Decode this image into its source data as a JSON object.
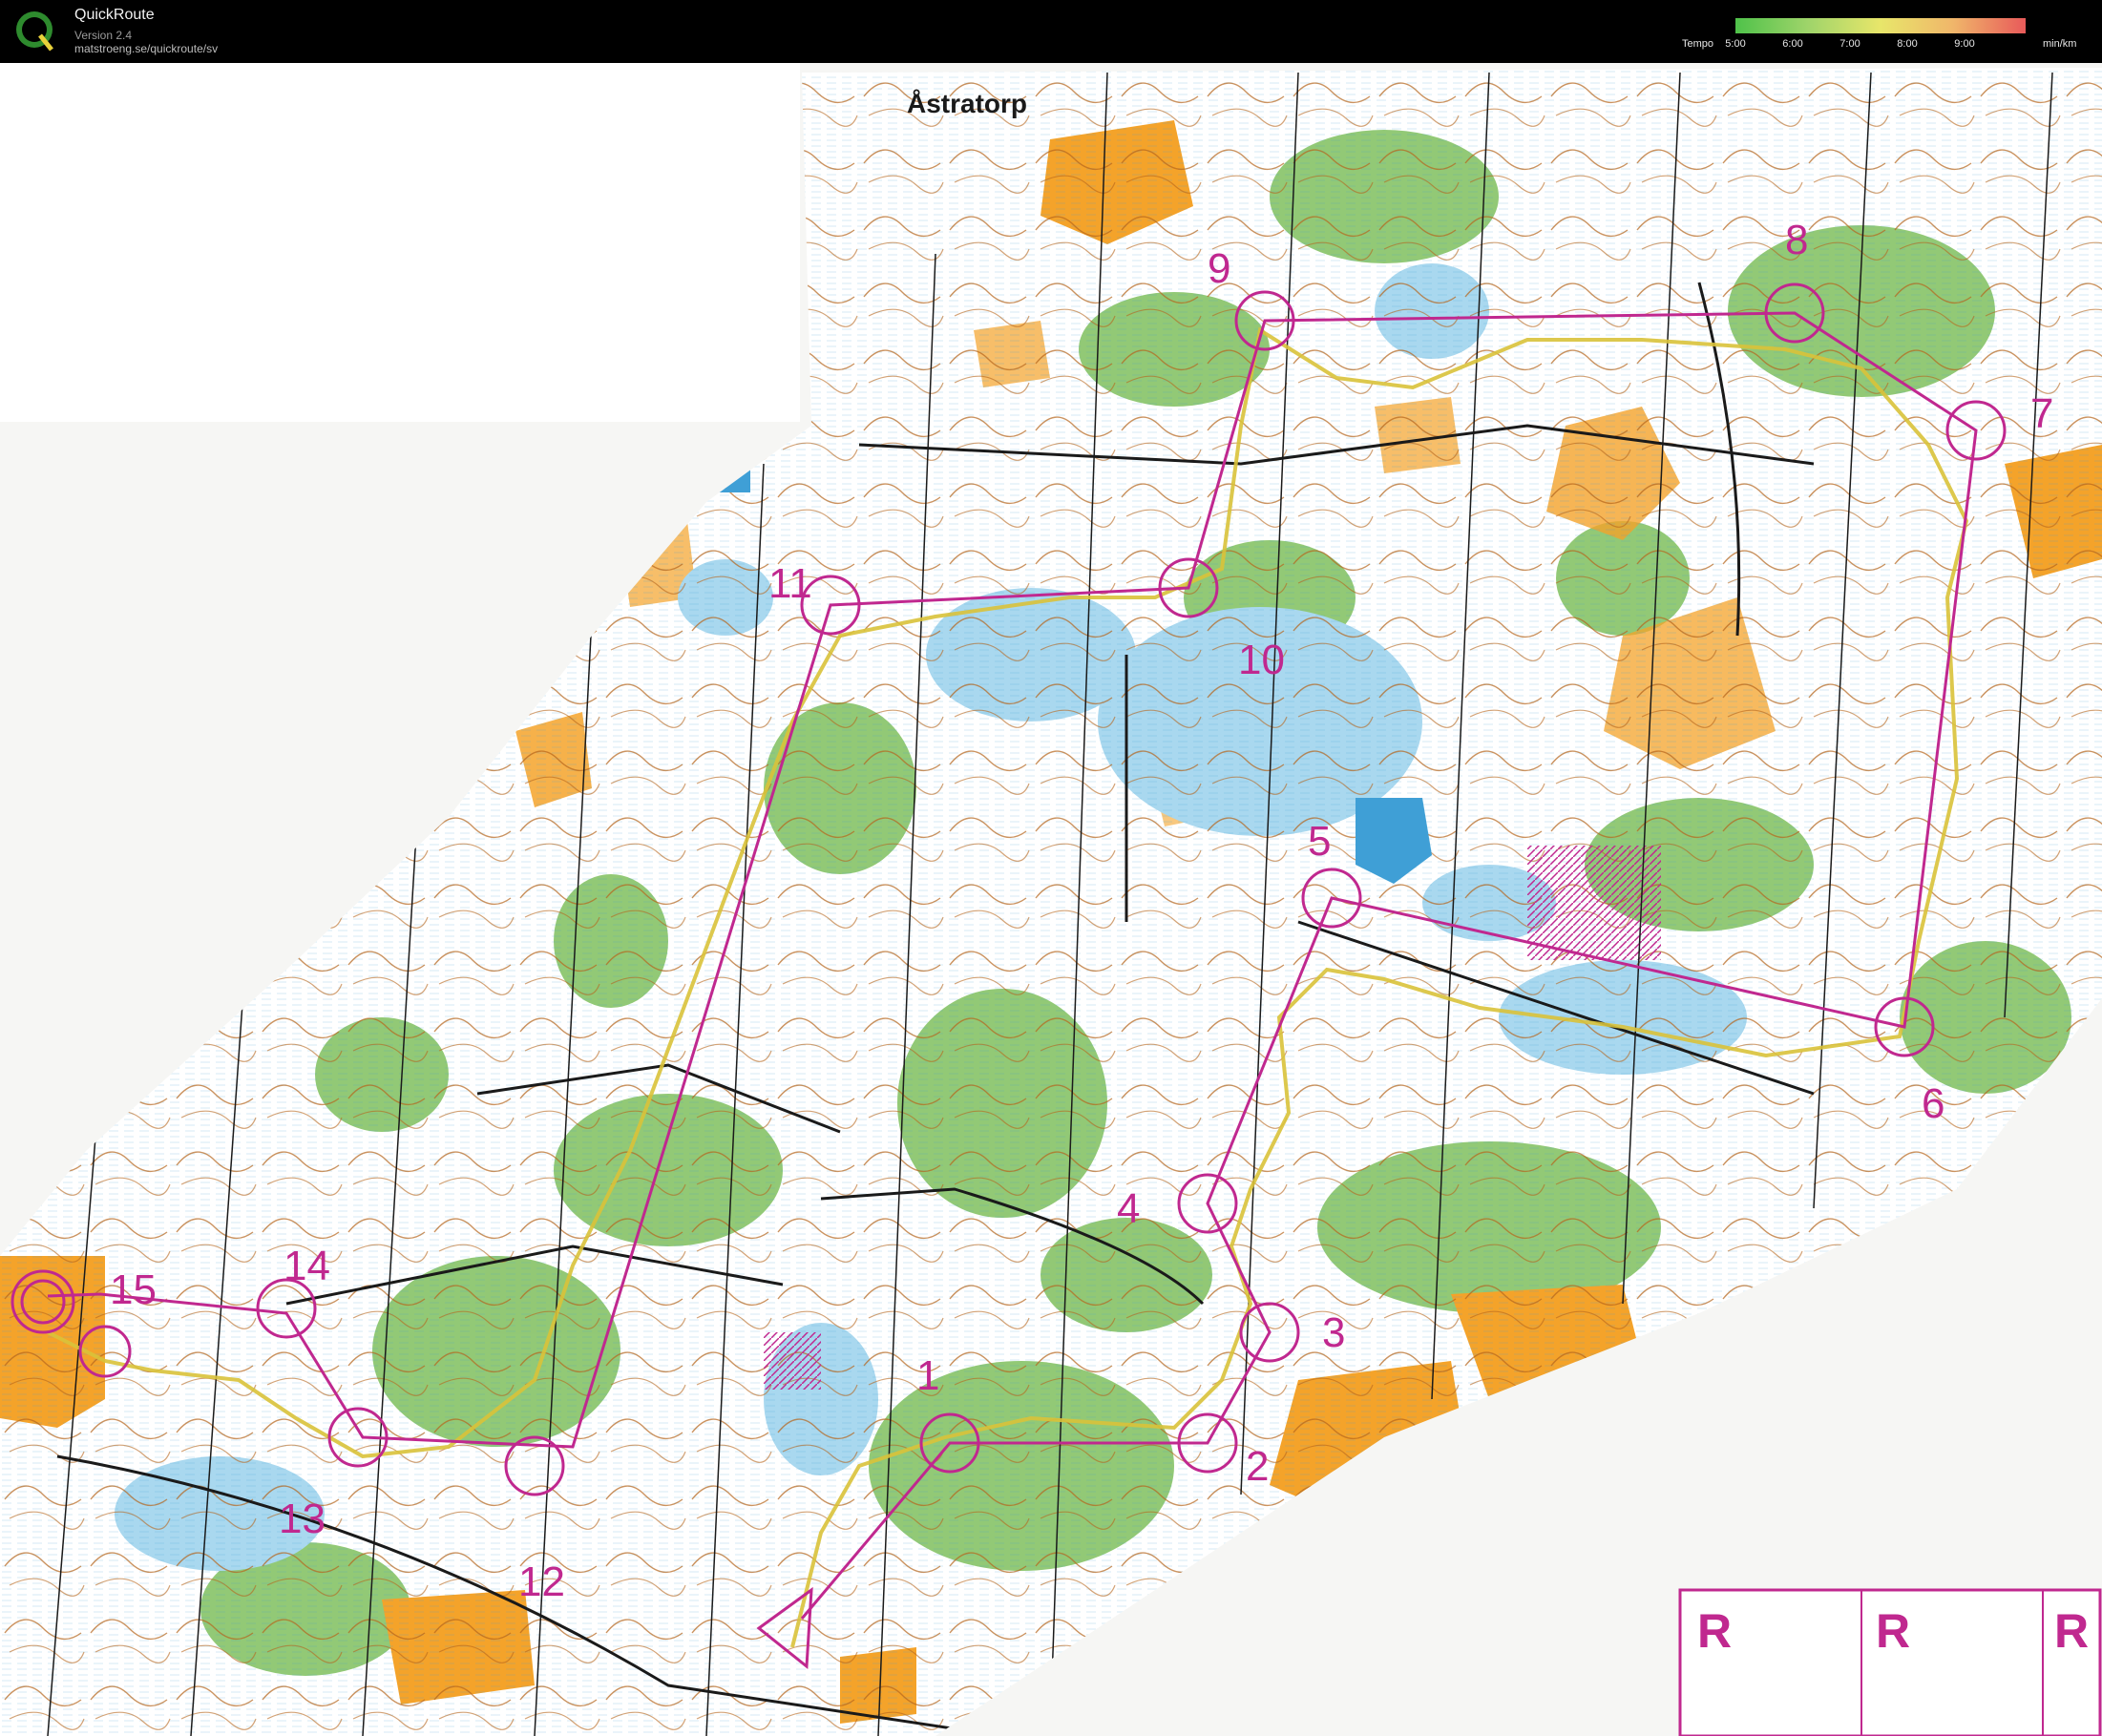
{
  "app": {
    "name": "QuickRoute",
    "version": "Version 2.4",
    "url": "matstroeng.se/quickroute/sv",
    "logo_letter": "Q"
  },
  "tempo_legend": {
    "label": "Tempo",
    "ticks": [
      "5:00",
      "6:00",
      "7:00",
      "8:00",
      "9:00"
    ],
    "unit": "min/km",
    "colors": [
      "#4fc24a",
      "#9fd46a",
      "#e8e66a",
      "#f0b66a",
      "#e85a5a"
    ]
  },
  "map": {
    "place_name": "Åstratorp",
    "course_color": "#c0288f",
    "controls": [
      {
        "label": "1"
      },
      {
        "label": "2"
      },
      {
        "label": "3"
      },
      {
        "label": "4"
      },
      {
        "label": "5"
      },
      {
        "label": "6"
      },
      {
        "label": "7"
      },
      {
        "label": "8"
      },
      {
        "label": "9"
      },
      {
        "label": "10"
      },
      {
        "label": "11"
      },
      {
        "label": "12"
      },
      {
        "label": "13"
      },
      {
        "label": "14"
      },
      {
        "label": "15"
      }
    ],
    "legend_boxes": [
      "R",
      "R",
      "R"
    ],
    "terrain_colors": {
      "open": "#f4a32a",
      "forest": "#7fbf5e",
      "marsh": "#a9d8ef",
      "contour": "#b5651d",
      "track": "#1a1a1a",
      "route": "#d9c23a"
    }
  }
}
